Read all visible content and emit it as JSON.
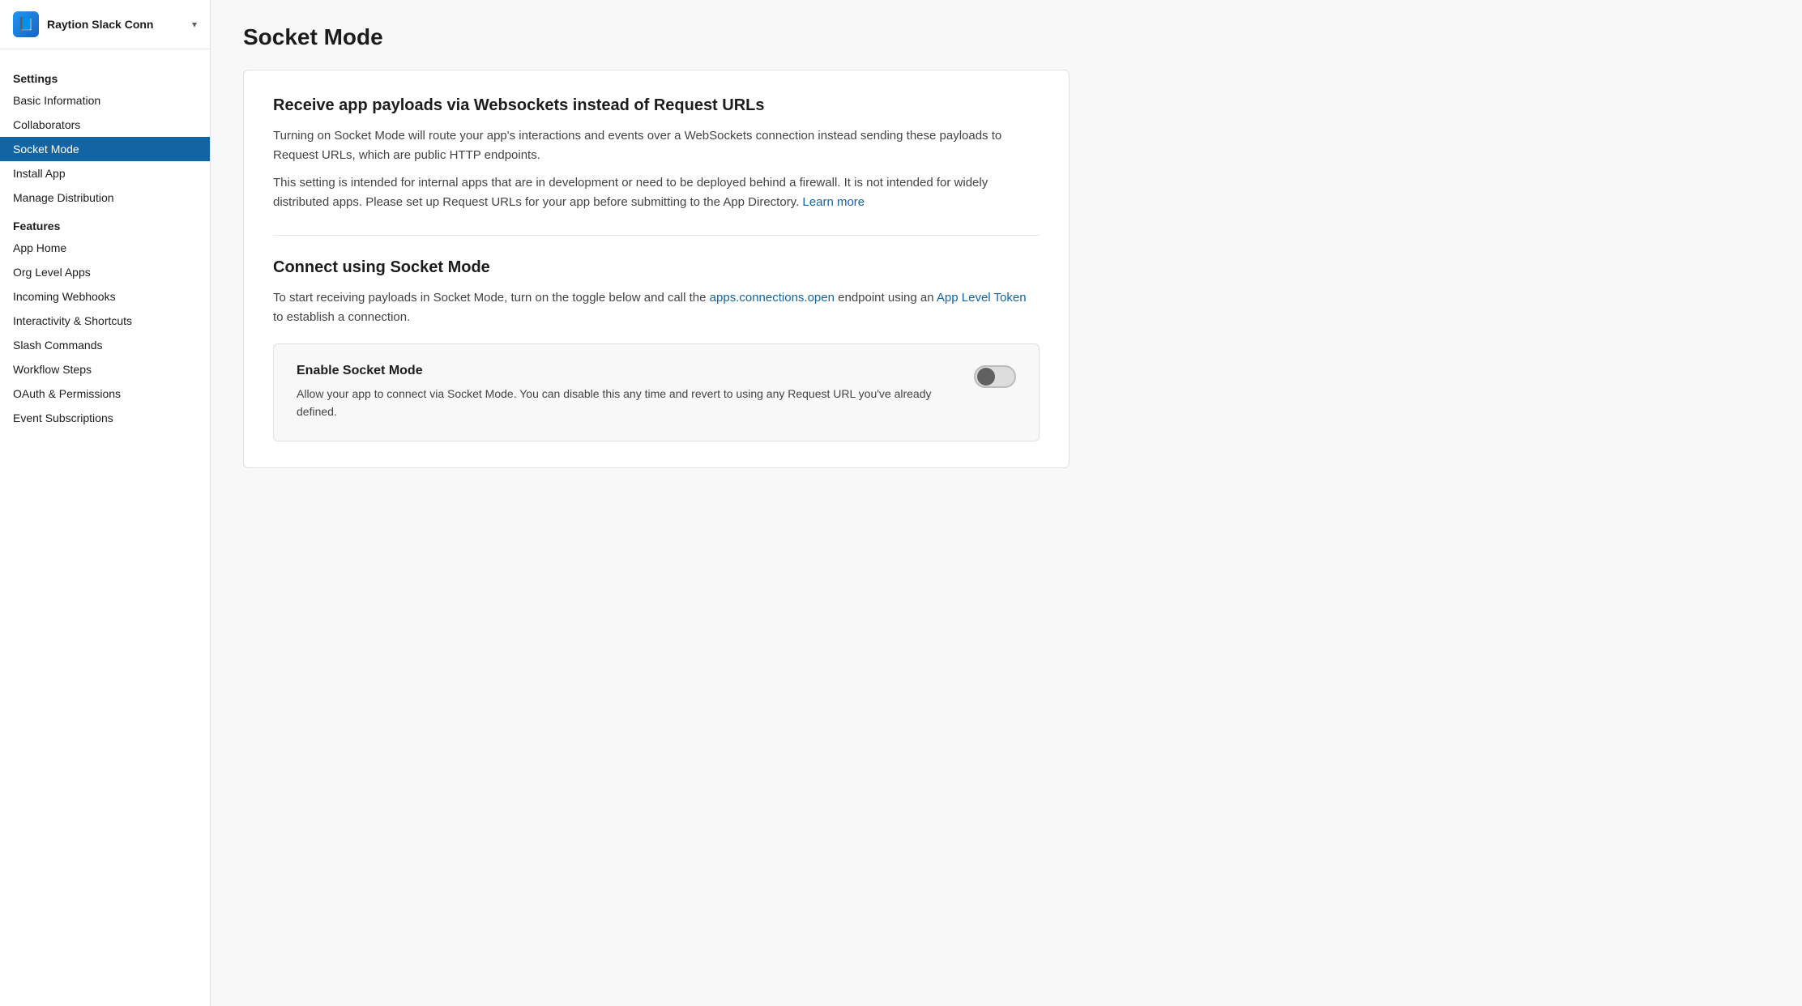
{
  "app": {
    "name": "Raytion Slack Conn",
    "icon": "📘"
  },
  "sidebar": {
    "settings_label": "Settings",
    "features_label": "Features",
    "items_settings": [
      {
        "id": "basic-information",
        "label": "Basic Information",
        "active": false
      },
      {
        "id": "collaborators",
        "label": "Collaborators",
        "active": false
      },
      {
        "id": "socket-mode",
        "label": "Socket Mode",
        "active": true
      },
      {
        "id": "install-app",
        "label": "Install App",
        "active": false
      },
      {
        "id": "manage-distribution",
        "label": "Manage Distribution",
        "active": false
      }
    ],
    "items_features": [
      {
        "id": "app-home",
        "label": "App Home",
        "active": false
      },
      {
        "id": "org-level-apps",
        "label": "Org Level Apps",
        "active": false
      },
      {
        "id": "incoming-webhooks",
        "label": "Incoming Webhooks",
        "active": false
      },
      {
        "id": "interactivity-shortcuts",
        "label": "Interactivity & Shortcuts",
        "active": false
      },
      {
        "id": "slash-commands",
        "label": "Slash Commands",
        "active": false
      },
      {
        "id": "workflow-steps",
        "label": "Workflow Steps",
        "active": false
      },
      {
        "id": "oauth-permissions",
        "label": "OAuth & Permissions",
        "active": false
      },
      {
        "id": "event-subscriptions",
        "label": "Event Subscriptions",
        "active": false
      }
    ]
  },
  "main": {
    "page_title": "Socket Mode",
    "section1": {
      "heading": "Receive app payloads via Websockets instead of Request URLs",
      "paragraph1": "Turning on Socket Mode will route your app's interactions and events over a WebSockets connection instead sending these payloads to Request URLs, which are public HTTP endpoints.",
      "paragraph2": "This setting is intended for internal apps that are in development or need to be deployed behind a firewall. It is not intended for widely distributed apps. Please set up Request URLs for your app before submitting to the App Directory.",
      "learn_more_text": "Learn more"
    },
    "section2": {
      "heading": "Connect using Socket Mode",
      "body_text1": "To start receiving payloads in Socket Mode, turn on the toggle below and call the",
      "link1_text": "apps.connections.open",
      "body_text2": "endpoint using an",
      "link2_text": "App Level Token",
      "body_text3": "to establish a connection.",
      "enable_box": {
        "title": "Enable Socket Mode",
        "description": "Allow your app to connect via Socket Mode. You can disable this any time and revert to using any Request URL you've already defined.",
        "toggle_enabled": false
      }
    }
  },
  "chevron_char": "▾"
}
